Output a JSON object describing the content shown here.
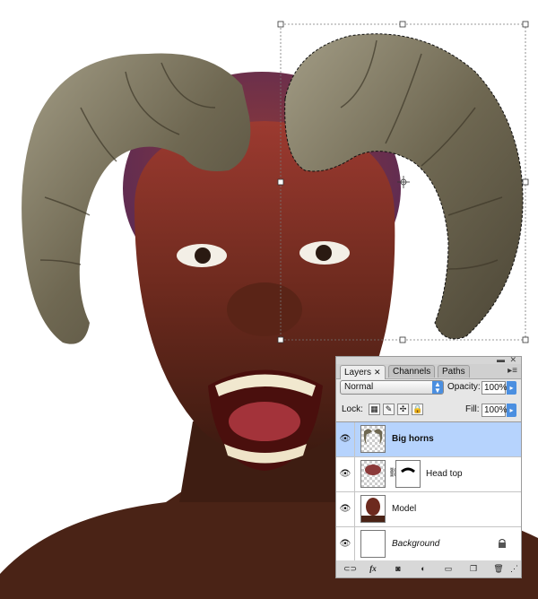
{
  "panel": {
    "tabs": [
      {
        "label": "Layers",
        "close": "✕"
      },
      {
        "label": "Channels"
      },
      {
        "label": "Paths"
      }
    ],
    "blend_mode": "Normal",
    "opacity_label": "Opacity:",
    "opacity_value": "100%",
    "lock_label": "Lock:",
    "fill_label": "Fill:",
    "fill_value": "100%",
    "layers": [
      {
        "name": "Big horns",
        "selected": true,
        "style": "bold"
      },
      {
        "name": "Head top",
        "selected": false,
        "style": "normal",
        "has_mask": true
      },
      {
        "name": "Model",
        "selected": false,
        "style": "normal"
      },
      {
        "name": "Background",
        "selected": false,
        "style": "italic",
        "locked": true
      }
    ],
    "fx_label": "fx"
  },
  "colors": {
    "selection_blue": "#b6d3fd",
    "accent_blue": "#4b8fe0",
    "skin": "#7a2e22",
    "horn": "#7d7560"
  }
}
